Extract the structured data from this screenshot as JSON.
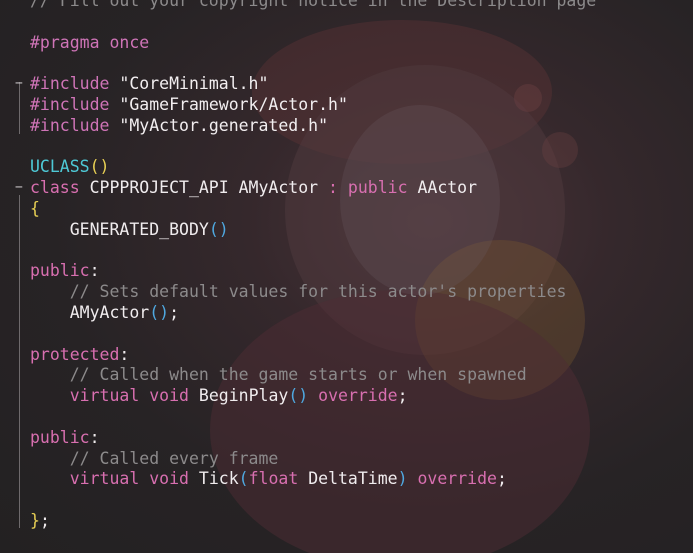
{
  "editor": {
    "lines": [
      [
        {
          "c": "cmt",
          "t": "// Fill out your copyright notice in the Description page"
        }
      ],
      [],
      [
        {
          "c": "pp",
          "t": "#pragma once"
        }
      ],
      [],
      [
        {
          "c": "pp",
          "t": "#include"
        },
        {
          "c": "txt",
          "t": " "
        },
        {
          "c": "str",
          "t": "\"CoreMinimal.h\""
        }
      ],
      [
        {
          "c": "pp",
          "t": "#include"
        },
        {
          "c": "txt",
          "t": " "
        },
        {
          "c": "str",
          "t": "\"GameFramework/Actor.h\""
        }
      ],
      [
        {
          "c": "pp",
          "t": "#include"
        },
        {
          "c": "txt",
          "t": " "
        },
        {
          "c": "str",
          "t": "\"MyActor.generated.h\""
        }
      ],
      [],
      [
        {
          "c": "mac",
          "t": "UCLASS"
        },
        {
          "c": "par",
          "t": "()"
        }
      ],
      [
        {
          "c": "kw",
          "t": "class"
        },
        {
          "c": "txt",
          "t": " CPPPROJECT_API AMyActor "
        },
        {
          "c": "kw",
          "t": ":"
        },
        {
          "c": "txt",
          "t": " "
        },
        {
          "c": "kw",
          "t": "public"
        },
        {
          "c": "txt",
          "t": " AActor"
        }
      ],
      [
        {
          "c": "par",
          "t": "{"
        }
      ],
      [
        {
          "c": "txt",
          "t": "    GENERATED_BODY"
        },
        {
          "c": "par2",
          "t": "()"
        }
      ],
      [],
      [
        {
          "c": "kw",
          "t": "public"
        },
        {
          "c": "txt",
          "t": ":"
        }
      ],
      [
        {
          "c": "txt",
          "t": "    "
        },
        {
          "c": "cmt",
          "t": "// Sets default values for this actor's properties"
        }
      ],
      [
        {
          "c": "txt",
          "t": "    AMyActor"
        },
        {
          "c": "par2",
          "t": "()"
        },
        {
          "c": "txt",
          "t": ";"
        }
      ],
      [],
      [
        {
          "c": "kw",
          "t": "protected"
        },
        {
          "c": "txt",
          "t": ":"
        }
      ],
      [
        {
          "c": "txt",
          "t": "    "
        },
        {
          "c": "cmt",
          "t": "// Called when the game starts or when spawned"
        }
      ],
      [
        {
          "c": "txt",
          "t": "    "
        },
        {
          "c": "kw",
          "t": "virtual"
        },
        {
          "c": "txt",
          "t": " "
        },
        {
          "c": "kw",
          "t": "void"
        },
        {
          "c": "txt",
          "t": " BeginPlay"
        },
        {
          "c": "par2",
          "t": "()"
        },
        {
          "c": "txt",
          "t": " "
        },
        {
          "c": "kw",
          "t": "override"
        },
        {
          "c": "txt",
          "t": ";"
        }
      ],
      [],
      [
        {
          "c": "kw",
          "t": "public"
        },
        {
          "c": "txt",
          "t": ":"
        }
      ],
      [
        {
          "c": "txt",
          "t": "    "
        },
        {
          "c": "cmt",
          "t": "// Called every frame"
        }
      ],
      [
        {
          "c": "txt",
          "t": "    "
        },
        {
          "c": "kw",
          "t": "virtual"
        },
        {
          "c": "txt",
          "t": " "
        },
        {
          "c": "kw",
          "t": "void"
        },
        {
          "c": "txt",
          "t": " Tick"
        },
        {
          "c": "par2",
          "t": "("
        },
        {
          "c": "kw",
          "t": "float"
        },
        {
          "c": "txt",
          "t": " DeltaTime"
        },
        {
          "c": "par2",
          "t": ")"
        },
        {
          "c": "txt",
          "t": " "
        },
        {
          "c": "kw",
          "t": "override"
        },
        {
          "c": "txt",
          "t": ";"
        }
      ],
      [],
      [
        {
          "c": "par",
          "t": "}"
        },
        {
          "c": "txt",
          "t": ";"
        }
      ]
    ]
  },
  "colors": {
    "comment": "#8c8a8b",
    "preprocessor": "#cf74b7",
    "keyword": "#d86fb0",
    "macro": "#4ec9d6",
    "brace": "#e7cf54",
    "paren": "#4fa8e0",
    "text": "#f0ecee"
  }
}
